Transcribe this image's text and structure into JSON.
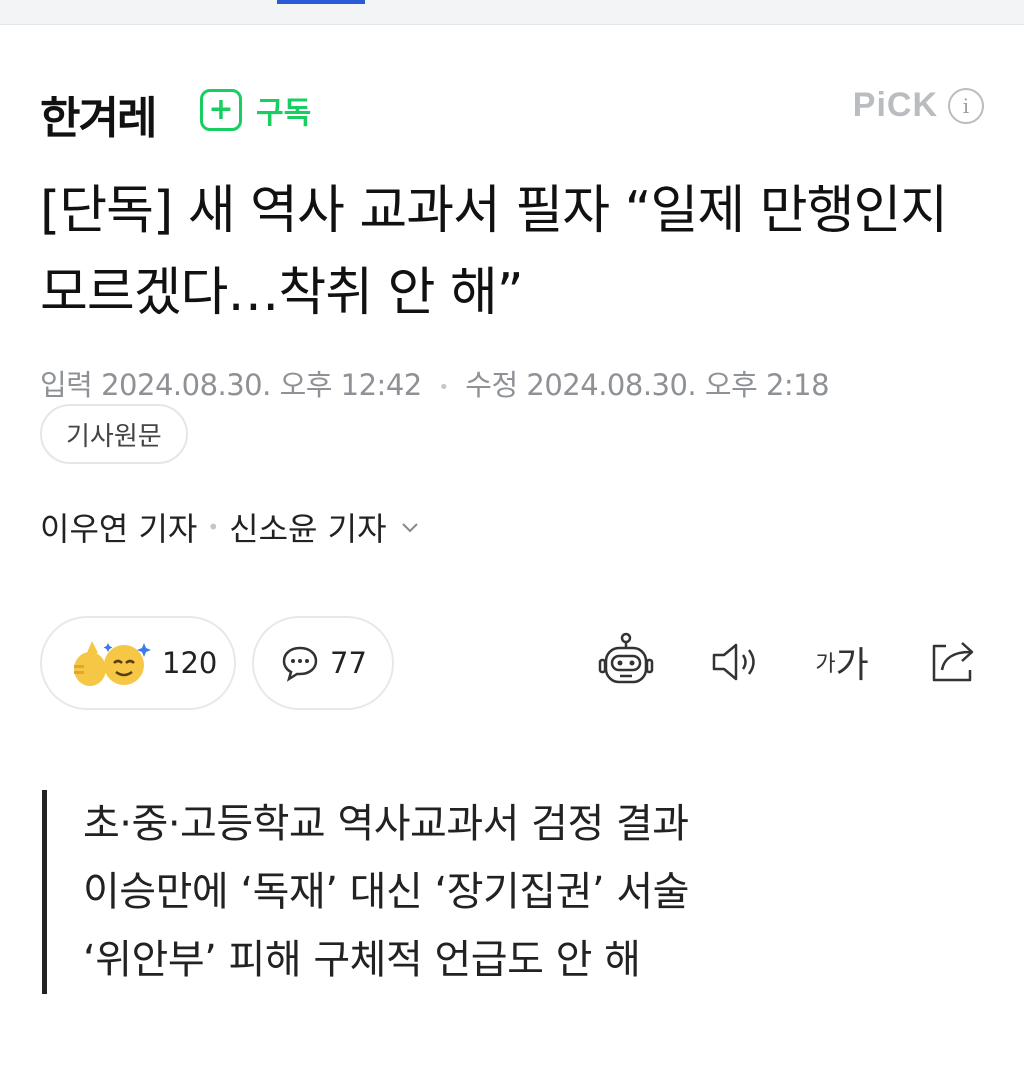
{
  "header": {
    "press_name": "한겨레",
    "subscribe_plus": "+",
    "subscribe_label": "구독",
    "pick_label": "PiCK",
    "info_label": "i"
  },
  "article": {
    "headline": "[단독] 새 역사 교과서 필자 “일제 만행인지 모르겠다…착취 안 해”",
    "input_label": "입력",
    "input_date": "2024.08.30. 오후 12:42",
    "modified_label": "수정",
    "modified_date": "2024.08.30. 오후 2:18",
    "original_button": "기사원문",
    "reporters": [
      "이우연 기자",
      "신소윤 기자"
    ]
  },
  "actions": {
    "reaction_count": "120",
    "comment_count": "77",
    "font_size_small": "가",
    "font_size_large": "가"
  },
  "summary": {
    "lines": [
      "초·중·고등학교 역사교과서 검정 결과",
      "이승만에 ‘독재’ 대신 ‘장기집권’ 서술",
      "‘위안부’ 피해 구체적 언급도 안 해"
    ]
  },
  "colors": {
    "brand_green": "#19ce60",
    "active_tab": "#2a5bd7",
    "muted_text": "#8e9196"
  }
}
